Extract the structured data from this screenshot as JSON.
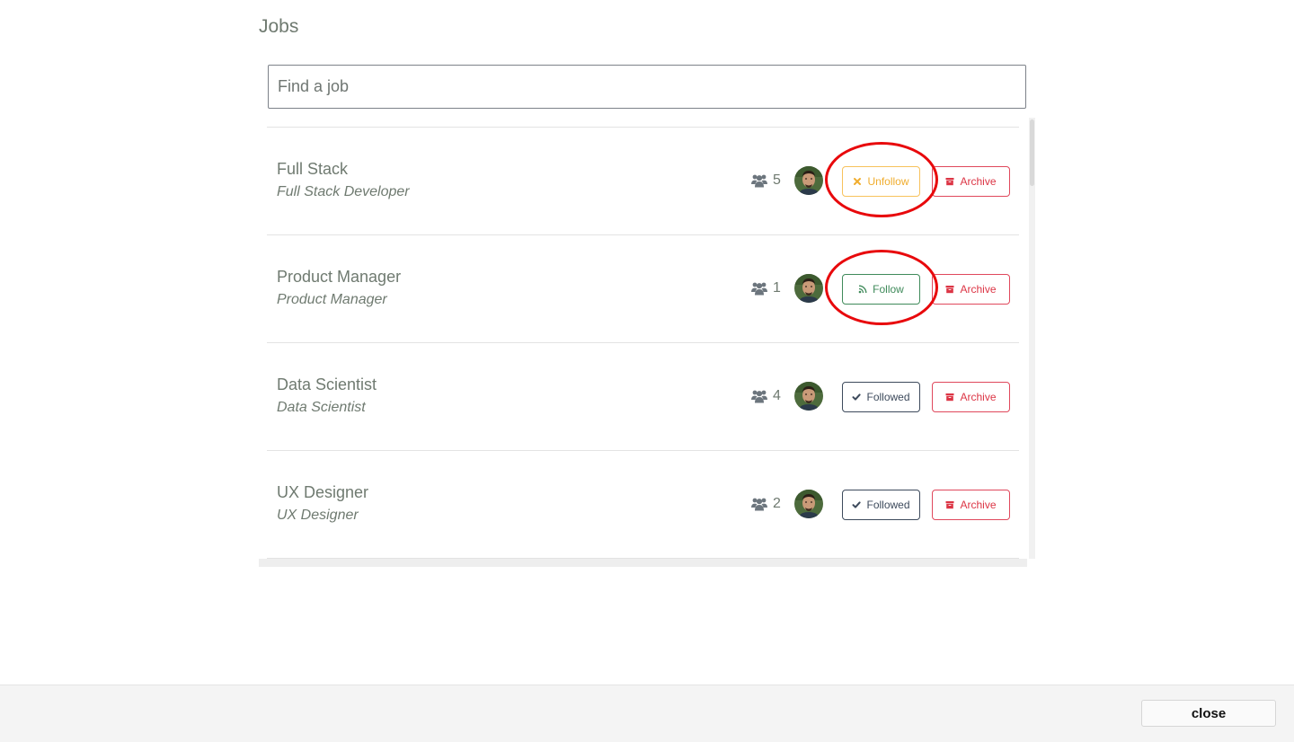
{
  "page": {
    "title": "Jobs"
  },
  "search": {
    "placeholder": "Find a job",
    "value": ""
  },
  "jobs": [
    {
      "title": "Full Stack",
      "subtitle": "Full Stack Developer",
      "member_count": "5",
      "follow_label": "Unfollow",
      "follow_state": "unfollow",
      "follow_icon": "close-icon",
      "archive_label": "Archive",
      "highlighted": true
    },
    {
      "title": "Product Manager",
      "subtitle": "Product Manager",
      "member_count": "1",
      "follow_label": "Follow",
      "follow_state": "follow",
      "follow_icon": "rss-icon",
      "archive_label": "Archive",
      "highlighted": true
    },
    {
      "title": "Data Scientist",
      "subtitle": "Data Scientist",
      "member_count": "4",
      "follow_label": "Followed",
      "follow_state": "followed",
      "follow_icon": "check-icon",
      "archive_label": "Archive",
      "highlighted": false
    },
    {
      "title": "UX Designer",
      "subtitle": "UX Designer",
      "member_count": "2",
      "follow_label": "Followed",
      "follow_state": "followed",
      "follow_icon": "check-icon",
      "archive_label": "Archive",
      "highlighted": false
    }
  ],
  "footer": {
    "close_label": "close"
  },
  "colors": {
    "unfollow": "#f0ad2e",
    "follow": "#3f8a5a",
    "followed": "#3d4a5c",
    "archive": "#dc3545",
    "annotation": "#e8090c"
  }
}
